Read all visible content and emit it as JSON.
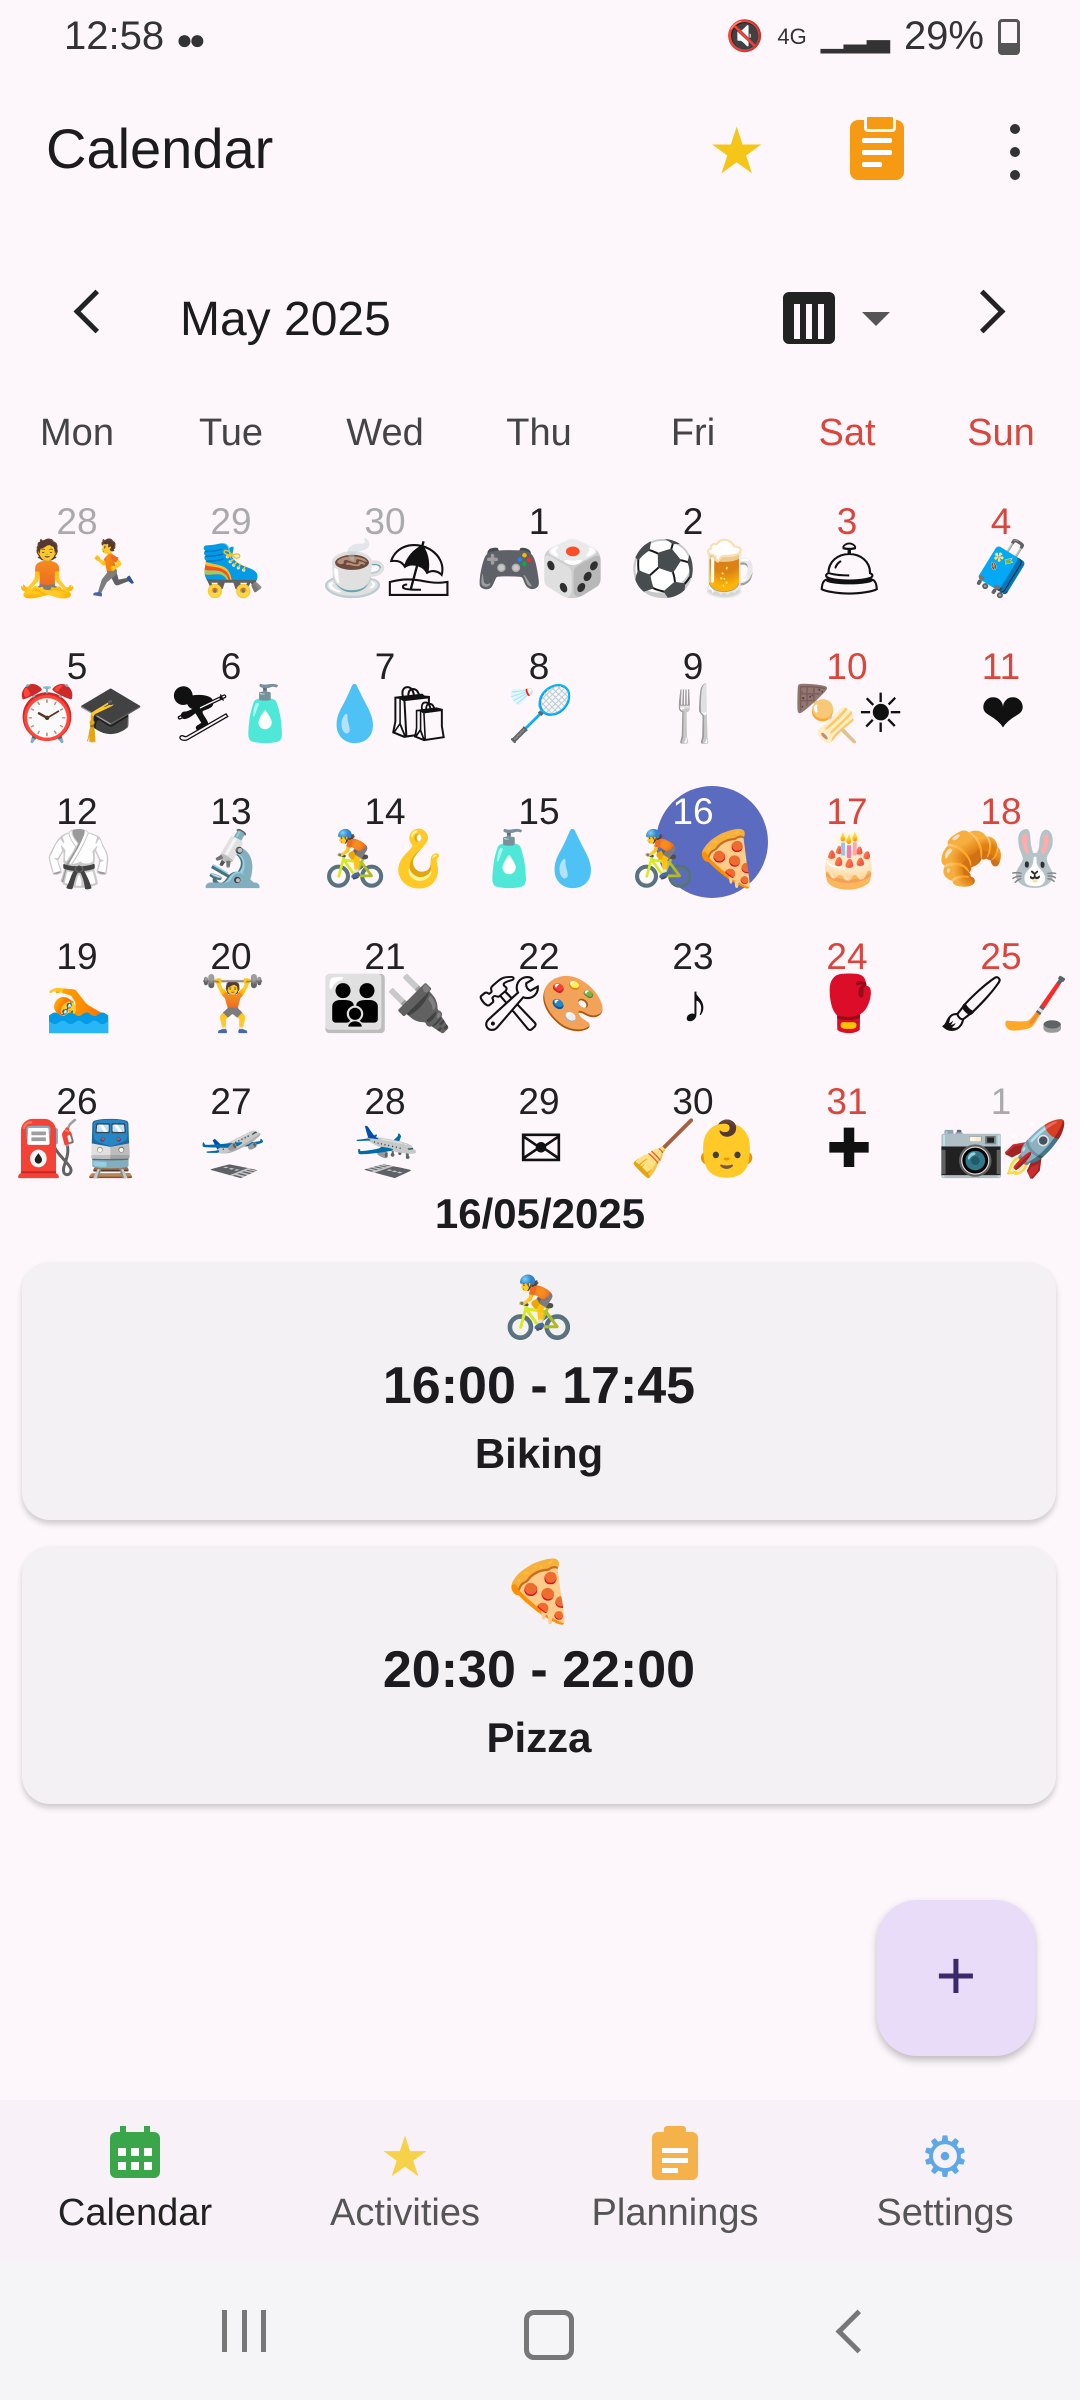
{
  "status": {
    "time": "12:58",
    "battery": "29%",
    "icons": [
      "notifications-icon",
      "mute-icon",
      "network-4g-icon",
      "signal-icon"
    ]
  },
  "appbar": {
    "title": "Calendar",
    "icons": [
      "star-icon",
      "clipboard-icon",
      "more-vert-icon"
    ]
  },
  "month": {
    "label": "May 2025"
  },
  "weekdays": [
    "Mon",
    "Tue",
    "Wed",
    "Thu",
    "Fri",
    "Sat",
    "Sun"
  ],
  "weeks": [
    [
      {
        "n": "28",
        "icons": "🧘🏃"
      },
      {
        "n": "29",
        "icons": "🛼"
      },
      {
        "n": "30",
        "icons": "☕⛱"
      },
      {
        "n": "1",
        "icons": "🎮🎲"
      },
      {
        "n": "2",
        "icons": "⚽🍺"
      },
      {
        "n": "3",
        "icons": "🛎"
      },
      {
        "n": "4",
        "icons": "🧳"
      }
    ],
    [
      {
        "n": "5",
        "icons": "⏰🎓"
      },
      {
        "n": "6",
        "icons": "⛷🧴"
      },
      {
        "n": "7",
        "icons": "💧🛍"
      },
      {
        "n": "8",
        "icons": "🏸"
      },
      {
        "n": "9",
        "icons": "🍴"
      },
      {
        "n": "10",
        "icons": "🍢☀"
      },
      {
        "n": "11",
        "icons": "❤"
      }
    ],
    [
      {
        "n": "12",
        "icons": "🥋"
      },
      {
        "n": "13",
        "icons": "🔬"
      },
      {
        "n": "14",
        "icons": "🚴🪝"
      },
      {
        "n": "15",
        "icons": "🧴💧"
      },
      {
        "n": "16",
        "icons": "🚴🍕"
      },
      {
        "n": "17",
        "icons": "🎂"
      },
      {
        "n": "18",
        "icons": "🥐🐰"
      }
    ],
    [
      {
        "n": "19",
        "icons": "🏊"
      },
      {
        "n": "20",
        "icons": "🏋"
      },
      {
        "n": "21",
        "icons": "👪🔌"
      },
      {
        "n": "22",
        "icons": "🛠🎨"
      },
      {
        "n": "23",
        "icons": "♪"
      },
      {
        "n": "24",
        "icons": "🥊"
      },
      {
        "n": "25",
        "icons": "🖌🏒"
      }
    ],
    [
      {
        "n": "26",
        "icons": "⛽🚆"
      },
      {
        "n": "27",
        "icons": "🛫"
      },
      {
        "n": "28",
        "icons": "🛬"
      },
      {
        "n": "29",
        "icons": "✉"
      },
      {
        "n": "30",
        "icons": "🧹👶"
      },
      {
        "n": "31",
        "icons": "✚"
      },
      {
        "n": "1",
        "icons": "📷🚀"
      }
    ]
  ],
  "selected_date": "16/05/2025",
  "events": [
    {
      "icon": "bike-icon",
      "glyph": "🚴",
      "time": "16:00 - 17:45",
      "name": "Biking"
    },
    {
      "icon": "pizza-icon",
      "glyph": "🍕",
      "time": "20:30 - 22:00",
      "name": "Pizza"
    }
  ],
  "fab": {
    "label": "+"
  },
  "bottom_nav": [
    {
      "label": "Calendar",
      "icon": "calendar-icon",
      "color": "#3aa64a"
    },
    {
      "label": "Activities",
      "icon": "star-icon",
      "color": "#f5d24a"
    },
    {
      "label": "Plannings",
      "icon": "clipboard-icon",
      "color": "#f5b24a"
    },
    {
      "label": "Settings",
      "icon": "gear-icon",
      "color": "#5ea8e8"
    }
  ]
}
